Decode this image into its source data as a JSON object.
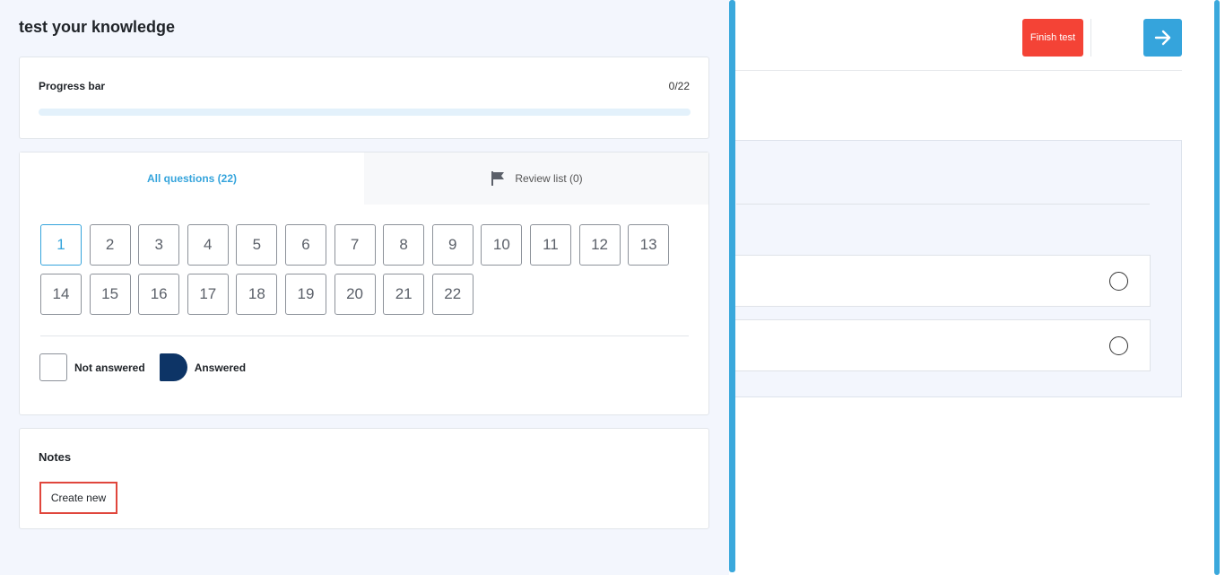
{
  "header": {
    "finish_label": "Finish test",
    "next_icon": "arrow-right-icon",
    "accent_color": "#35a4dc",
    "finish_color": "#f44336"
  },
  "question_options": [
    {
      "selected": false
    },
    {
      "selected": false
    }
  ],
  "panel": {
    "title": "test your knowledge",
    "progress": {
      "label": "Progress bar",
      "count": "0/22",
      "fraction": 0
    },
    "tabs": [
      {
        "label": "All questions (22)",
        "active": true
      },
      {
        "label": "Review list (0)",
        "active": false,
        "icon": "flag-icon"
      }
    ],
    "questions": [
      "1",
      "2",
      "3",
      "4",
      "5",
      "6",
      "7",
      "8",
      "9",
      "10",
      "11",
      "12",
      "13",
      "14",
      "15",
      "16",
      "17",
      "18",
      "19",
      "20",
      "21",
      "22"
    ],
    "current_question": "1",
    "legend": {
      "not_answered": "Not answered",
      "answered": "Answered",
      "answered_color": "#0d3466"
    },
    "notes": {
      "title": "Notes",
      "create_label": "Create new"
    }
  }
}
